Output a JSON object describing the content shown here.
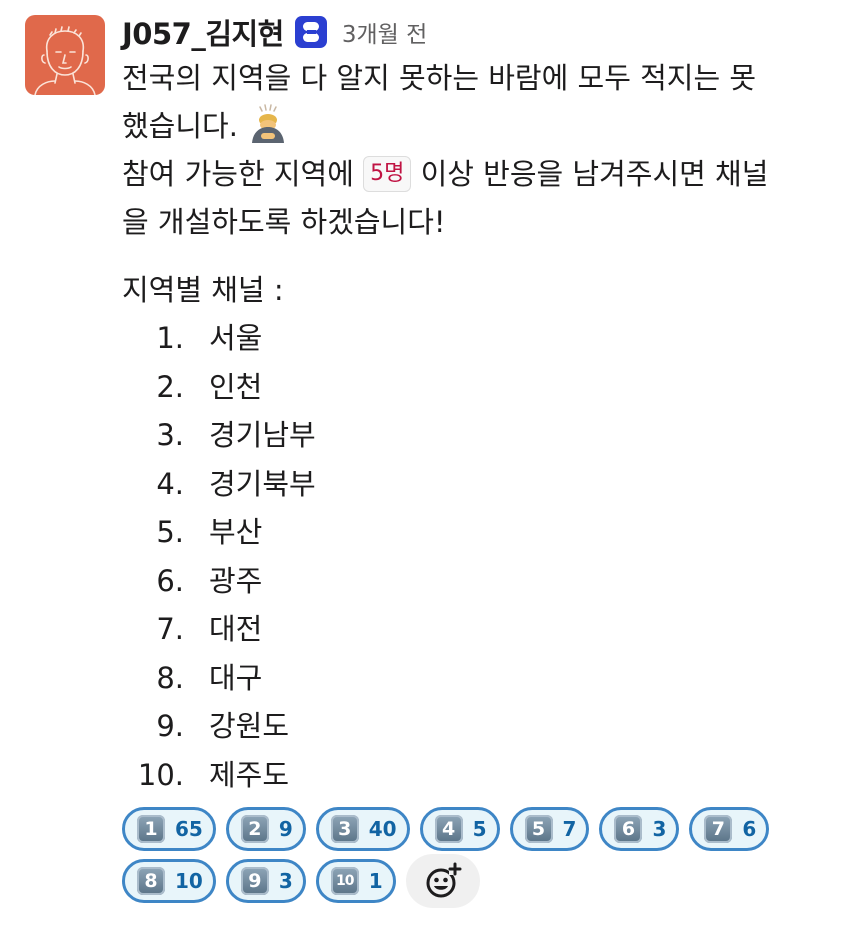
{
  "message": {
    "author": "J057_김지현",
    "timestamp": "3개월 전",
    "lines": [
      "전국의 지역을 다 알지 못하는 바람에 모두 적지는 못",
      "했습니다."
    ],
    "line3_before": "참여 가능한 지역에",
    "line3_code": "5명",
    "line3_after": "이상 반응을 남겨주시면 채널",
    "line4": "을 개설하도록 하겠습니다!",
    "list_heading": "지역별 채널 :",
    "regions": [
      {
        "num": "1.",
        "label": "서울"
      },
      {
        "num": "2.",
        "label": "인천"
      },
      {
        "num": "3.",
        "label": "경기남부"
      },
      {
        "num": "4.",
        "label": "경기북부"
      },
      {
        "num": "5.",
        "label": "부산"
      },
      {
        "num": "6.",
        "label": "광주"
      },
      {
        "num": "7.",
        "label": "대전"
      },
      {
        "num": "8.",
        "label": "대구"
      },
      {
        "num": "9.",
        "label": "강원도"
      },
      {
        "num": "10.",
        "label": "제주도"
      }
    ]
  },
  "reactions": [
    {
      "emoji": "keycap-1",
      "key": "1",
      "count": "65"
    },
    {
      "emoji": "keycap-2",
      "key": "2",
      "count": "9"
    },
    {
      "emoji": "keycap-3",
      "key": "3",
      "count": "40"
    },
    {
      "emoji": "keycap-4",
      "key": "4",
      "count": "5"
    },
    {
      "emoji": "keycap-5",
      "key": "5",
      "count": "7"
    },
    {
      "emoji": "keycap-6",
      "key": "6",
      "count": "3"
    },
    {
      "emoji": "keycap-7",
      "key": "7",
      "count": "6"
    },
    {
      "emoji": "keycap-8",
      "key": "8",
      "count": "10"
    },
    {
      "emoji": "keycap-9",
      "key": "9",
      "count": "3"
    },
    {
      "emoji": "keycap-10",
      "key": "10",
      "count": "1"
    }
  ],
  "icons": {
    "avatar": "avatar-sketch-icon",
    "app_badge": "app-badge-icon",
    "bow_emoji": "person-bowing-icon",
    "add_reaction": "add-reaction-icon"
  },
  "colors": {
    "avatar_bg": "#e0694b",
    "reaction_border": "#3e86c6",
    "reaction_bg": "#e8f5fa",
    "count_text": "#1264a3",
    "code_text": "#c01343",
    "timestamp": "#616061"
  }
}
